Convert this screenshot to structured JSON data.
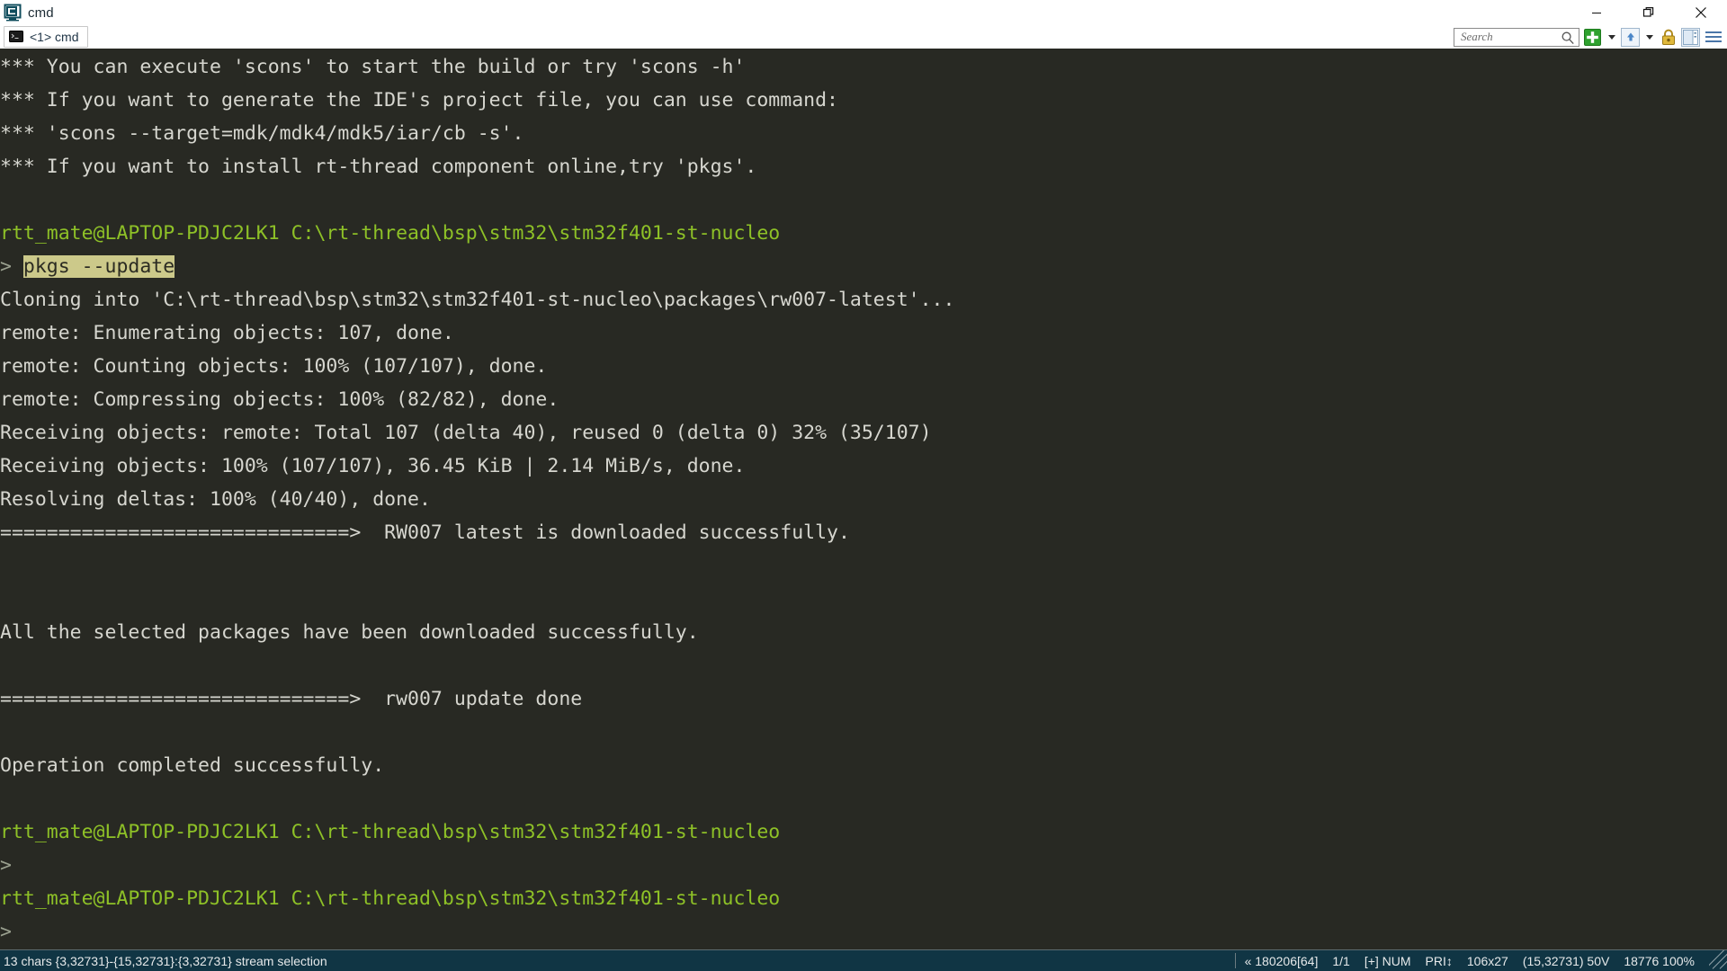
{
  "window": {
    "title": "cmd",
    "app_icon": "conemu-icon",
    "buttons": {
      "minimize": "minimize-icon",
      "restore": "restore-icon",
      "close": "close-icon"
    }
  },
  "tabs": [
    {
      "label": "<1> cmd",
      "icon": "console-icon",
      "active": true
    }
  ],
  "toolbar": {
    "search": {
      "placeholder": "Search",
      "value": "",
      "icon": "magnifier-icon"
    },
    "new_console": {
      "icon": "new-console-plus-icon",
      "label": ""
    },
    "new_console_caret": {
      "icon": "chevron-down-icon"
    },
    "active_console": {
      "icon": "up-arrow-icon"
    },
    "active_console_caret": {
      "icon": "chevron-down-icon"
    },
    "lock": {
      "icon": "padlock-icon"
    },
    "panels": {
      "icon": "panel-view-icon"
    },
    "menu": {
      "icon": "hamburger-menu-icon"
    }
  },
  "terminal": {
    "background": "#282923",
    "foreground": "#d6d6cf",
    "prompt_color": "#8ec127",
    "selection_background": "#ccc98a",
    "lines": [
      {
        "type": "out",
        "text": "*** You can execute 'scons' to start the build or try 'scons -h'"
      },
      {
        "type": "out",
        "text": "*** If you want to generate the IDE's project file, you can use command:"
      },
      {
        "type": "out",
        "text": "*** 'scons --target=mdk/mdk4/mdk5/iar/cb -s'."
      },
      {
        "type": "out",
        "text": "*** If you want to install rt-thread component online,try 'pkgs'."
      },
      {
        "type": "blank",
        "text": ""
      },
      {
        "type": "prompt",
        "text": "rtt_mate@LAPTOP-PDJC2LK1 C:\\rt-thread\\bsp\\stm32\\stm32f401-st-nucleo"
      },
      {
        "type": "command",
        "caret": "> ",
        "text": "pkgs --update",
        "selected": true
      },
      {
        "type": "out",
        "text": "Cloning into 'C:\\rt-thread\\bsp\\stm32\\stm32f401-st-nucleo\\packages\\rw007-latest'..."
      },
      {
        "type": "out",
        "text": "remote: Enumerating objects: 107, done."
      },
      {
        "type": "out",
        "text": "remote: Counting objects: 100% (107/107), done."
      },
      {
        "type": "out",
        "text": "remote: Compressing objects: 100% (82/82), done."
      },
      {
        "type": "out",
        "text": "Receiving objects: remote: Total 107 (delta 40), reused 0 (delta 0) 32% (35/107)"
      },
      {
        "type": "out",
        "text": "Receiving objects: 100% (107/107), 36.45 KiB | 2.14 MiB/s, done."
      },
      {
        "type": "out",
        "text": "Resolving deltas: 100% (40/40), done."
      },
      {
        "type": "out",
        "text": "==============================>  RW007 latest is downloaded successfully."
      },
      {
        "type": "blank",
        "text": ""
      },
      {
        "type": "blank",
        "text": ""
      },
      {
        "type": "out",
        "text": "All the selected packages have been downloaded successfully."
      },
      {
        "type": "blank",
        "text": ""
      },
      {
        "type": "out",
        "text": "==============================>  rw007 update done"
      },
      {
        "type": "blank",
        "text": ""
      },
      {
        "type": "out",
        "text": "Operation completed successfully."
      },
      {
        "type": "blank",
        "text": ""
      },
      {
        "type": "prompt",
        "text": "rtt_mate@LAPTOP-PDJC2LK1 C:\\rt-thread\\bsp\\stm32\\stm32f401-st-nucleo"
      },
      {
        "type": "caret",
        "text": ">"
      },
      {
        "type": "prompt",
        "text": "rtt_mate@LAPTOP-PDJC2LK1 C:\\rt-thread\\bsp\\stm32\\stm32f401-st-nucleo"
      },
      {
        "type": "caret",
        "text": ">"
      }
    ]
  },
  "statusbar": {
    "left": "13 chars {3,32731}-{15,32731}:{3,32731} stream selection",
    "right": [
      "« 180206[64]",
      "1/1",
      "[+] NUM",
      "PRI↕",
      "106x27",
      "(15,32731) 50V",
      "18776 100%"
    ],
    "background": "#103544",
    "foreground": "#e6e9ea"
  }
}
